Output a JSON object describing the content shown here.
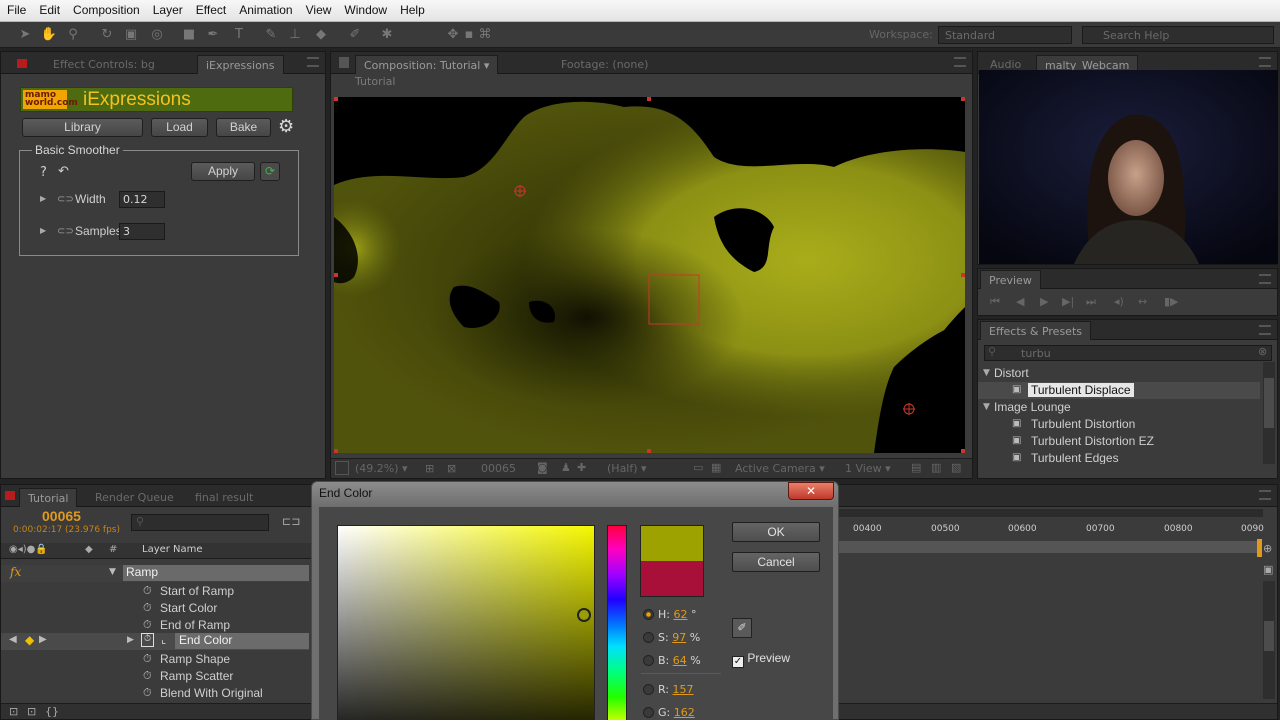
{
  "menubar": {
    "items": [
      "File",
      "Edit",
      "Composition",
      "Layer",
      "Effect",
      "Animation",
      "View",
      "Window",
      "Help"
    ]
  },
  "toolbar": {
    "workspace_label": "Workspace:",
    "workspace_value": "Standard",
    "search_placeholder": "Search Help"
  },
  "left_panel": {
    "tabs": [
      "Effect Controls: bg",
      "iExpressions"
    ],
    "logo_text": "mamo world.com",
    "title": "iExpressions",
    "buttons": {
      "library": "Library",
      "load": "Load",
      "bake": "Bake"
    },
    "group_title": "Basic Smoother",
    "help": "?",
    "apply": "Apply",
    "properties": [
      {
        "label": "Width",
        "value": "0.12"
      },
      {
        "label": "Samples",
        "value": "3"
      }
    ]
  },
  "composition": {
    "tabs": [
      "Composition: Tutorial",
      "Footage: (none)"
    ],
    "breadcrumb": "Tutorial",
    "footer": {
      "zoom": "(49.2%)",
      "frame": "00065",
      "resolution": "(Half)",
      "camera": "Active Camera",
      "view": "1 View"
    }
  },
  "webcam": {
    "tabs": [
      "Audio",
      "malty_Webcam"
    ]
  },
  "preview": {
    "tab": "Preview"
  },
  "effects_presets": {
    "tab": "Effects & Presets",
    "search_value": "turbu",
    "groups": [
      {
        "name": "Distort",
        "items": [
          "Turbulent Displace"
        ]
      },
      {
        "name": "Image Lounge",
        "items": [
          "Turbulent Distortion",
          "Turbulent Distortion EZ",
          "Turbulent Edges"
        ]
      }
    ],
    "selected_item": "Turbulent Displace"
  },
  "timeline": {
    "tabs": [
      "Tutorial",
      "Render Queue",
      "final result"
    ],
    "timecode": "00065",
    "timecode_sub": "0:00:02:17 (23.976 fps)",
    "search_placeholder": "",
    "column_layer_name": "Layer Name",
    "column_num": "#",
    "fx_label": "fx",
    "effect_name": "Ramp",
    "properties": [
      "Start of Ramp",
      "Start Color",
      "End of Ramp",
      "End Color",
      "Ramp Shape",
      "Ramp Scatter",
      "Blend With Original"
    ],
    "selected_property": "End Color",
    "ruler": [
      "00400",
      "00500",
      "00600",
      "00700",
      "00800",
      "0090"
    ]
  },
  "color_dialog": {
    "title": "End Color",
    "ok": "OK",
    "cancel": "Cancel",
    "preview_label": "Preview",
    "new_color": "#9da200",
    "old_color": "#a8103a",
    "hsb": [
      {
        "label": "H:",
        "value": "62",
        "unit": "°"
      },
      {
        "label": "S:",
        "value": "97",
        "unit": "%"
      },
      {
        "label": "B:",
        "value": "64",
        "unit": "%"
      }
    ],
    "rgb": [
      {
        "label": "R:",
        "value": "157"
      },
      {
        "label": "G:",
        "value": "162"
      }
    ]
  },
  "colors": {
    "accent_orange": "#e09a1b",
    "logo_green": "#4f6b10",
    "comp_yellow": "#9ba215",
    "selection_red": "#c8372c"
  }
}
